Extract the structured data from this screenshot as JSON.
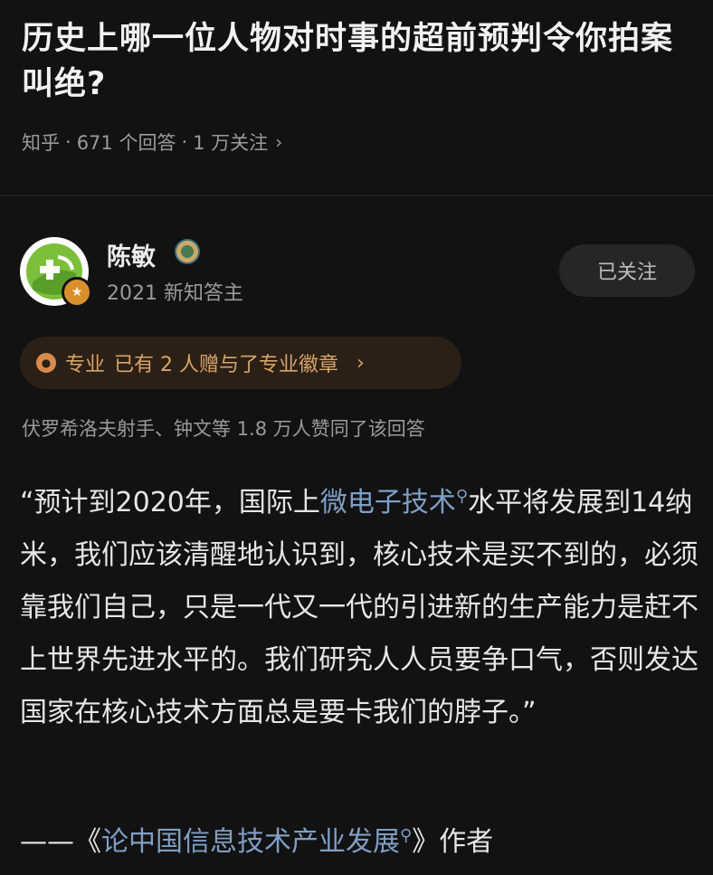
{
  "question": {
    "title": "历史上哪一位人物对时事的超前预判令你拍案叫绝?",
    "source": "知乎",
    "answers": "671 个回答",
    "followers": "1 万关注",
    "sep": "·"
  },
  "answer": {
    "author_name": "陈敏",
    "author_sub": "2021 新知答主",
    "follow_label": "已关注",
    "pro_label": "专业",
    "pro_text": "已有 2 人赠与了专业徽章",
    "likes_text": "伏罗希洛夫射手、钟文等 1.8 万人赞同了该回答",
    "body": {
      "p1": "“预计到2020年，国际上",
      "link1": "微电子技术",
      "p2": "水平将发展到14纳米，我们应该清醒地认识到，核心技术是买不到的，必须靠我们自己，只是一代又一代的引进新的生产能力是赶不上世界先进水平的。我们研究人人员要争口气，否则发达国家在核心技术方面总是要卡我们的脖子。”"
    },
    "source_line": {
      "prefix": "——《",
      "link": "论中国信息技术产业发展",
      "suffix": "》作者"
    }
  },
  "icons": {
    "chevron": "chevron-right-icon",
    "search_hint": "search-hint-icon",
    "badge": "badge-icon"
  }
}
